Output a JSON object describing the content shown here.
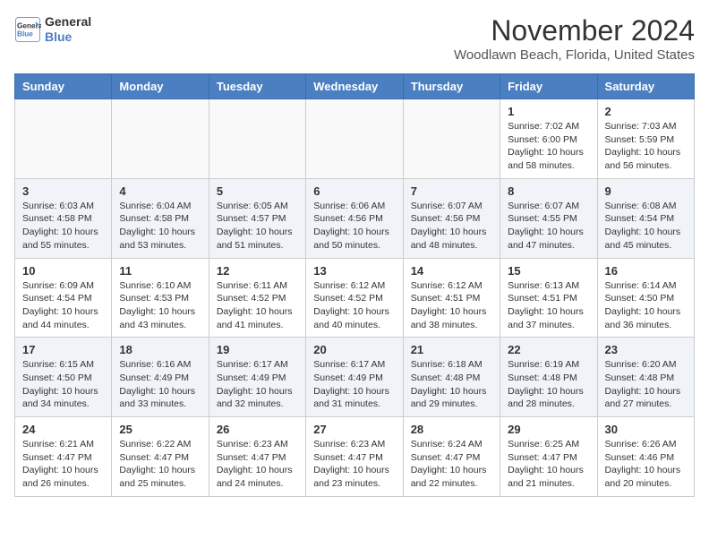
{
  "header": {
    "logo_general": "General",
    "logo_blue": "Blue",
    "month_title": "November 2024",
    "location": "Woodlawn Beach, Florida, United States"
  },
  "days_of_week": [
    "Sunday",
    "Monday",
    "Tuesday",
    "Wednesday",
    "Thursday",
    "Friday",
    "Saturday"
  ],
  "weeks": [
    {
      "days": [
        {
          "number": "",
          "info": ""
        },
        {
          "number": "",
          "info": ""
        },
        {
          "number": "",
          "info": ""
        },
        {
          "number": "",
          "info": ""
        },
        {
          "number": "",
          "info": ""
        },
        {
          "number": "1",
          "info": "Sunrise: 7:02 AM\nSunset: 6:00 PM\nDaylight: 10 hours\nand 58 minutes."
        },
        {
          "number": "2",
          "info": "Sunrise: 7:03 AM\nSunset: 5:59 PM\nDaylight: 10 hours\nand 56 minutes."
        }
      ]
    },
    {
      "days": [
        {
          "number": "3",
          "info": "Sunrise: 6:03 AM\nSunset: 4:58 PM\nDaylight: 10 hours\nand 55 minutes."
        },
        {
          "number": "4",
          "info": "Sunrise: 6:04 AM\nSunset: 4:58 PM\nDaylight: 10 hours\nand 53 minutes."
        },
        {
          "number": "5",
          "info": "Sunrise: 6:05 AM\nSunset: 4:57 PM\nDaylight: 10 hours\nand 51 minutes."
        },
        {
          "number": "6",
          "info": "Sunrise: 6:06 AM\nSunset: 4:56 PM\nDaylight: 10 hours\nand 50 minutes."
        },
        {
          "number": "7",
          "info": "Sunrise: 6:07 AM\nSunset: 4:56 PM\nDaylight: 10 hours\nand 48 minutes."
        },
        {
          "number": "8",
          "info": "Sunrise: 6:07 AM\nSunset: 4:55 PM\nDaylight: 10 hours\nand 47 minutes."
        },
        {
          "number": "9",
          "info": "Sunrise: 6:08 AM\nSunset: 4:54 PM\nDaylight: 10 hours\nand 45 minutes."
        }
      ]
    },
    {
      "days": [
        {
          "number": "10",
          "info": "Sunrise: 6:09 AM\nSunset: 4:54 PM\nDaylight: 10 hours\nand 44 minutes."
        },
        {
          "number": "11",
          "info": "Sunrise: 6:10 AM\nSunset: 4:53 PM\nDaylight: 10 hours\nand 43 minutes."
        },
        {
          "number": "12",
          "info": "Sunrise: 6:11 AM\nSunset: 4:52 PM\nDaylight: 10 hours\nand 41 minutes."
        },
        {
          "number": "13",
          "info": "Sunrise: 6:12 AM\nSunset: 4:52 PM\nDaylight: 10 hours\nand 40 minutes."
        },
        {
          "number": "14",
          "info": "Sunrise: 6:12 AM\nSunset: 4:51 PM\nDaylight: 10 hours\nand 38 minutes."
        },
        {
          "number": "15",
          "info": "Sunrise: 6:13 AM\nSunset: 4:51 PM\nDaylight: 10 hours\nand 37 minutes."
        },
        {
          "number": "16",
          "info": "Sunrise: 6:14 AM\nSunset: 4:50 PM\nDaylight: 10 hours\nand 36 minutes."
        }
      ]
    },
    {
      "days": [
        {
          "number": "17",
          "info": "Sunrise: 6:15 AM\nSunset: 4:50 PM\nDaylight: 10 hours\nand 34 minutes."
        },
        {
          "number": "18",
          "info": "Sunrise: 6:16 AM\nSunset: 4:49 PM\nDaylight: 10 hours\nand 33 minutes."
        },
        {
          "number": "19",
          "info": "Sunrise: 6:17 AM\nSunset: 4:49 PM\nDaylight: 10 hours\nand 32 minutes."
        },
        {
          "number": "20",
          "info": "Sunrise: 6:17 AM\nSunset: 4:49 PM\nDaylight: 10 hours\nand 31 minutes."
        },
        {
          "number": "21",
          "info": "Sunrise: 6:18 AM\nSunset: 4:48 PM\nDaylight: 10 hours\nand 29 minutes."
        },
        {
          "number": "22",
          "info": "Sunrise: 6:19 AM\nSunset: 4:48 PM\nDaylight: 10 hours\nand 28 minutes."
        },
        {
          "number": "23",
          "info": "Sunrise: 6:20 AM\nSunset: 4:48 PM\nDaylight: 10 hours\nand 27 minutes."
        }
      ]
    },
    {
      "days": [
        {
          "number": "24",
          "info": "Sunrise: 6:21 AM\nSunset: 4:47 PM\nDaylight: 10 hours\nand 26 minutes."
        },
        {
          "number": "25",
          "info": "Sunrise: 6:22 AM\nSunset: 4:47 PM\nDaylight: 10 hours\nand 25 minutes."
        },
        {
          "number": "26",
          "info": "Sunrise: 6:23 AM\nSunset: 4:47 PM\nDaylight: 10 hours\nand 24 minutes."
        },
        {
          "number": "27",
          "info": "Sunrise: 6:23 AM\nSunset: 4:47 PM\nDaylight: 10 hours\nand 23 minutes."
        },
        {
          "number": "28",
          "info": "Sunrise: 6:24 AM\nSunset: 4:47 PM\nDaylight: 10 hours\nand 22 minutes."
        },
        {
          "number": "29",
          "info": "Sunrise: 6:25 AM\nSunset: 4:47 PM\nDaylight: 10 hours\nand 21 minutes."
        },
        {
          "number": "30",
          "info": "Sunrise: 6:26 AM\nSunset: 4:46 PM\nDaylight: 10 hours\nand 20 minutes."
        }
      ]
    }
  ]
}
